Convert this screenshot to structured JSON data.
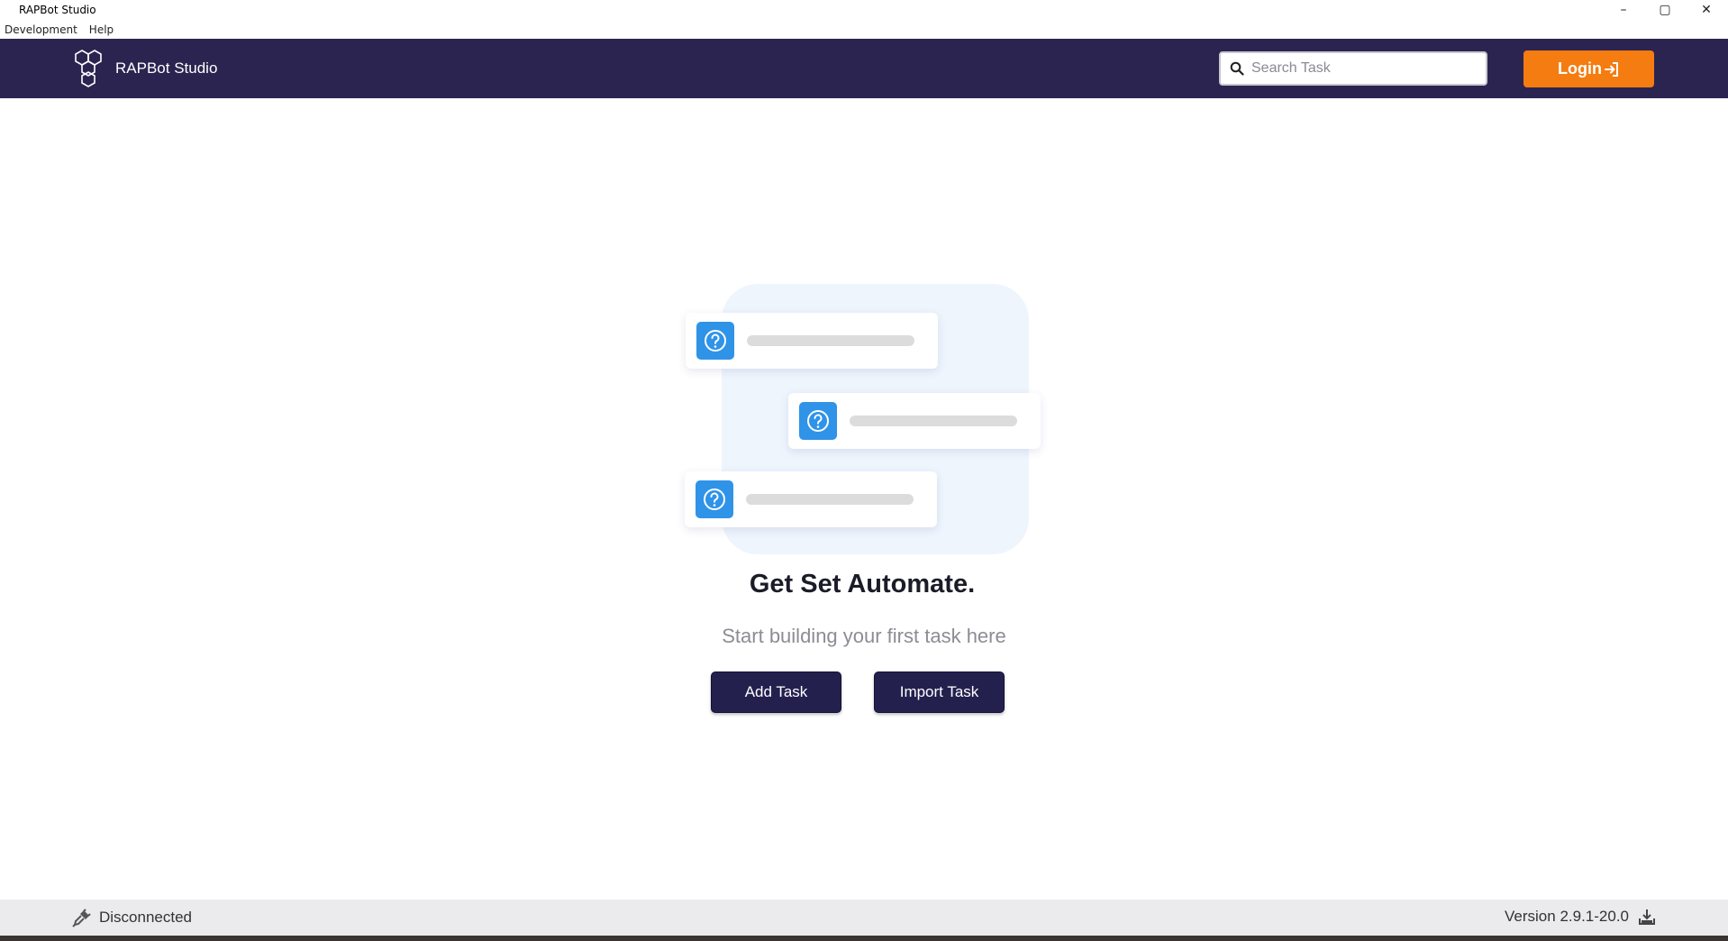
{
  "window": {
    "title": "RAPBot Studio",
    "controls": {
      "minimize": "–",
      "maximize": "▢",
      "close": "✕"
    }
  },
  "menubar": {
    "items": [
      "Development",
      "Help"
    ]
  },
  "header": {
    "brand_name": "RAPBot Studio",
    "search_placeholder": "Search Task",
    "login_label": "Login"
  },
  "main": {
    "headline": "Get Set Automate.",
    "subline": "Start building your first task here",
    "add_task_label": "Add Task",
    "import_task_label": "Import Task"
  },
  "statusbar": {
    "connection_status": "Disconnected",
    "version": "Version 2.9.1-20.0"
  },
  "colors": {
    "header_bg": "#2c2450",
    "login_bg": "#f57c10",
    "button_bg": "#24204e",
    "question_icon_bg": "#2f93e8",
    "illustration_bg": "#eef5fd"
  },
  "icons": {
    "brand": "hexagon-logo-icon",
    "search": "search-icon",
    "login": "login-arrow-icon",
    "card": "question-icon",
    "status": "plug-icon",
    "version": "download-icon"
  }
}
